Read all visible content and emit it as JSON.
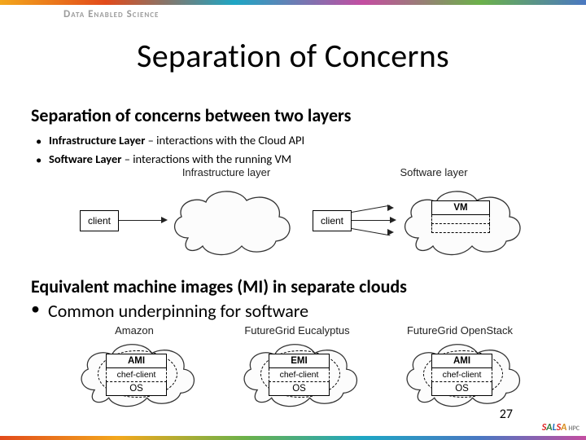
{
  "brand": "Data Enabled Science",
  "title": "Separation of Concerns",
  "subtitle1": "Separation of concerns between two layers",
  "bullets1": [
    {
      "bold": "Infrastructure Layer",
      "rest": " – interactions with the Cloud API"
    },
    {
      "bold": "Software Layer",
      "rest": " – interactions with the running VM"
    }
  ],
  "diagram1": {
    "caption_left": "Infrastructure layer",
    "caption_right": "Software layer",
    "client": "client",
    "cloud_right": {
      "vm": "VM",
      "vm_dashed": ""
    }
  },
  "subtitle2": "Equivalent machine images (MI) in separate clouds",
  "bullets2": [
    "Common underpinning for software"
  ],
  "diagram2": {
    "clouds": [
      {
        "caption": "Amazon",
        "mi": "AMI",
        "chef": "chef-client",
        "os": "OS"
      },
      {
        "caption": "FutureGrid Eucalyptus",
        "mi": "EMI",
        "chef": "chef-client",
        "os": "OS"
      },
      {
        "caption": "FutureGrid OpenStack",
        "mi": "AMI",
        "chef": "chef-client",
        "os": "OS"
      }
    ]
  },
  "pagenum": "27",
  "footer_logo": {
    "s": "S",
    "a1": "A",
    "l": "L",
    "s2": "S",
    "a2": "A",
    "hpc": "HPC"
  }
}
